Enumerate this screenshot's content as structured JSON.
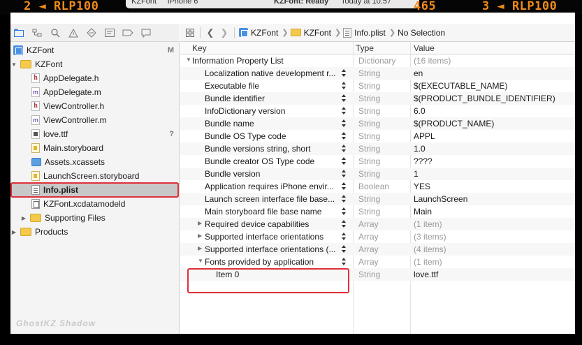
{
  "overlay": {
    "left_label": "2 ◄ RLP100",
    "mid_label": "465",
    "right_label": "3 ◄ RLP100"
  },
  "titlebar": {
    "scheme": "KZFont",
    "device": "iPhone 6",
    "status": "KZFont: Ready",
    "time": "Today at 10:57"
  },
  "navigator": {
    "tabs": [
      "folder-icon",
      "hierarchy-icon",
      "search-icon",
      "warning-icon",
      "test-icon",
      "debug-icon",
      "breakpoint-icon",
      "report-icon"
    ],
    "project": {
      "name": "KZFont",
      "badge": "M"
    },
    "group": "KZFont",
    "files": [
      {
        "name": "AppDelegate.h",
        "icon": "header-file-icon"
      },
      {
        "name": "AppDelegate.m",
        "icon": "source-file-icon"
      },
      {
        "name": "ViewController.h",
        "icon": "header-file-icon"
      },
      {
        "name": "ViewController.m",
        "icon": "source-file-icon"
      },
      {
        "name": "love.ttf",
        "icon": "font-file-icon",
        "badge": "?"
      },
      {
        "name": "Main.storyboard",
        "icon": "storyboard-icon"
      },
      {
        "name": "Assets.xcassets",
        "icon": "assets-icon"
      },
      {
        "name": "LaunchScreen.storyboard",
        "icon": "storyboard-icon"
      },
      {
        "name": "Info.plist",
        "icon": "plist-icon"
      },
      {
        "name": "KZFont.xcdatamodeld",
        "icon": "datamodel-icon"
      },
      {
        "name": "Supporting Files",
        "icon": "folder-icon"
      }
    ],
    "products": "Products",
    "watermark": "GhostKZ Shadow"
  },
  "jumpbar": {
    "project": "KZFont",
    "group": "KZFont",
    "file": "Info.plist",
    "selection": "No Selection"
  },
  "plist": {
    "headers": {
      "key": "Key",
      "type": "Type",
      "value": "Value"
    },
    "root": {
      "key": "Information Property List",
      "type": "Dictionary",
      "value": "(16 items)"
    },
    "rows": [
      {
        "key": "Localization native development r...",
        "type": "String",
        "value": "en"
      },
      {
        "key": "Executable file",
        "type": "String",
        "value": "$(EXECUTABLE_NAME)"
      },
      {
        "key": "Bundle identifier",
        "type": "String",
        "value": "$(PRODUCT_BUNDLE_IDENTIFIER)"
      },
      {
        "key": "InfoDictionary version",
        "type": "String",
        "value": "6.0"
      },
      {
        "key": "Bundle name",
        "type": "String",
        "value": "$(PRODUCT_NAME)"
      },
      {
        "key": "Bundle OS Type code",
        "type": "String",
        "value": "APPL"
      },
      {
        "key": "Bundle versions string, short",
        "type": "String",
        "value": "1.0"
      },
      {
        "key": "Bundle creator OS Type code",
        "type": "String",
        "value": "????"
      },
      {
        "key": "Bundle version",
        "type": "String",
        "value": "1"
      },
      {
        "key": "Application requires iPhone envir...",
        "type": "Boolean",
        "value": "YES"
      },
      {
        "key": "Launch screen interface file base...",
        "type": "String",
        "value": "LaunchScreen"
      },
      {
        "key": "Main storyboard file base name",
        "type": "String",
        "value": "Main"
      },
      {
        "key": "Required device capabilities",
        "type": "Array",
        "value": "(1 item)"
      },
      {
        "key": "Supported interface orientations",
        "type": "Array",
        "value": "(3 items)"
      },
      {
        "key": "Supported interface orientations (...",
        "type": "Array",
        "value": "(4 items)"
      },
      {
        "key": "Fonts provided by application",
        "type": "Array",
        "value": "(1 item)"
      },
      {
        "key": "Item 0",
        "type": "String",
        "value": "love.ttf"
      }
    ]
  },
  "colors": {
    "highlight": "#e0303a",
    "overlay_text": "#f08a1c"
  }
}
